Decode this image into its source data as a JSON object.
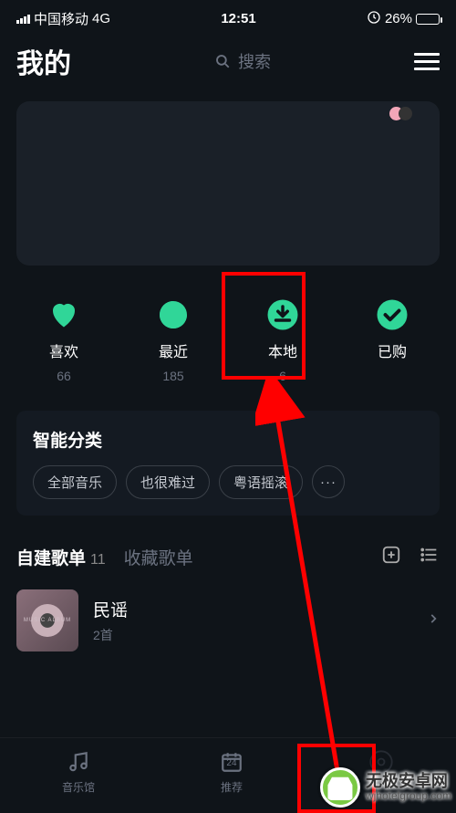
{
  "status": {
    "carrier": "中国移动",
    "network": "4G",
    "time": "12:51",
    "battery_pct": "26%"
  },
  "header": {
    "title": "我的",
    "search_placeholder": "搜索"
  },
  "stats": [
    {
      "icon": "heart",
      "label": "喜欢",
      "count": "66"
    },
    {
      "icon": "clock-pie",
      "label": "最近",
      "count": "185"
    },
    {
      "icon": "download",
      "label": "本地",
      "count": "6"
    },
    {
      "icon": "check-circle",
      "label": "已购",
      "count": ""
    }
  ],
  "smart_category": {
    "title": "智能分类",
    "pills": [
      "全部音乐",
      "也很难过",
      "粤语摇滚"
    ]
  },
  "playlist_section": {
    "tabs": [
      {
        "label": "自建歌单",
        "count": "11",
        "active": true
      },
      {
        "label": "收藏歌单",
        "active": false
      }
    ],
    "items": [
      {
        "name": "民谣",
        "meta": "2首"
      }
    ]
  },
  "bottom_nav": [
    {
      "icon": "music-note",
      "label": "音乐馆"
    },
    {
      "icon": "calendar-24",
      "label": "推荐",
      "badge": "24"
    }
  ],
  "watermark": {
    "main": "无极安卓网",
    "sub": "wjhotelgroup.com"
  },
  "colors": {
    "accent": "#30d698"
  }
}
